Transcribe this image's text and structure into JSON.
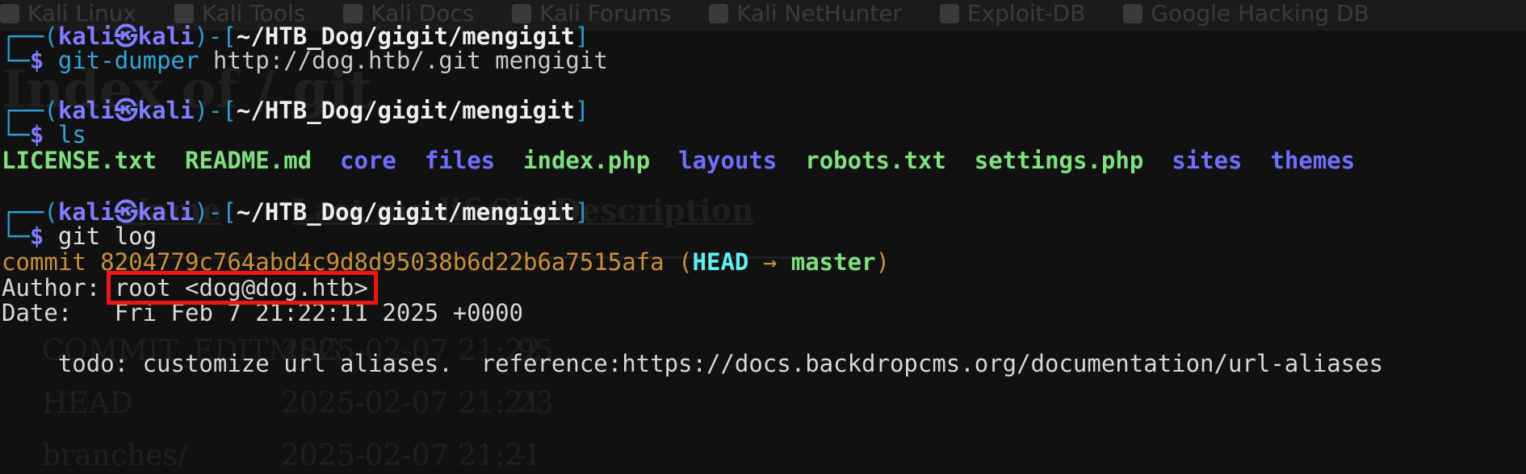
{
  "bookmarks": [
    "Kali Linux",
    "Kali Tools",
    "Kali Docs",
    "Kali Forums",
    "Kali NetHunter",
    "Exploit-DB",
    "Google Hacking DB"
  ],
  "background_page": {
    "title": "Index of / git",
    "headers": [
      "Name",
      "Last modified",
      "Size",
      "Description"
    ],
    "rows": [
      {
        "name": "COMMIT_EDITMSG",
        "date": "2025-02-07 21:22",
        "size": "95"
      },
      {
        "name": "HEAD",
        "date": "2025-02-07 21:21",
        "size": "23"
      },
      {
        "name": "branches/",
        "date": "2025-02-07 21:21",
        "size": "-"
      }
    ]
  },
  "prompt": {
    "open": "┌──(",
    "user": "kali㉿kali",
    "mid": ")-[",
    "path": "~/HTB_Dog/gigit/mengigit",
    "close": "]",
    "second": "└─",
    "dollar": "$"
  },
  "commands": [
    {
      "cmd": "git-dumper",
      "args": " http://dog.htb/.git mengigit"
    },
    {
      "cmd": "ls",
      "args": ""
    },
    {
      "cmd": "git",
      "args": " log"
    }
  ],
  "ls_output": [
    {
      "name": "LICENSE.txt",
      "type": "file"
    },
    {
      "name": "README.md",
      "type": "file"
    },
    {
      "name": "core",
      "type": "dir"
    },
    {
      "name": "files",
      "type": "dir"
    },
    {
      "name": "index.php",
      "type": "file"
    },
    {
      "name": "layouts",
      "type": "dir"
    },
    {
      "name": "robots.txt",
      "type": "file"
    },
    {
      "name": "settings.php",
      "type": "file"
    },
    {
      "name": "sites",
      "type": "dir"
    },
    {
      "name": "themes",
      "type": "dir"
    }
  ],
  "git_log": {
    "commit_label": "commit 8204779c764abd4c9d8d95038b6d22b6a7515afa",
    "paren_open": " (",
    "head": "HEAD",
    "arrow": " → ",
    "branch": "master",
    "paren_close": ")",
    "author_label": "Author: ",
    "author_value": "root <dog@dog.htb>",
    "date_label": "Date:   ",
    "date_value": "Fri Feb 7 21:22:11 2025 +0000",
    "message": "    todo: customize url aliases.  reference:https://docs.backdropcms.org/documentation/url-aliases"
  },
  "colors": {
    "highlight_box": "#f01515",
    "prompt_user": "#7f7cff",
    "file": "#7fe07f",
    "dir": "#6f6fff",
    "commit": "#c8903a",
    "head": "#5ff2f2"
  }
}
